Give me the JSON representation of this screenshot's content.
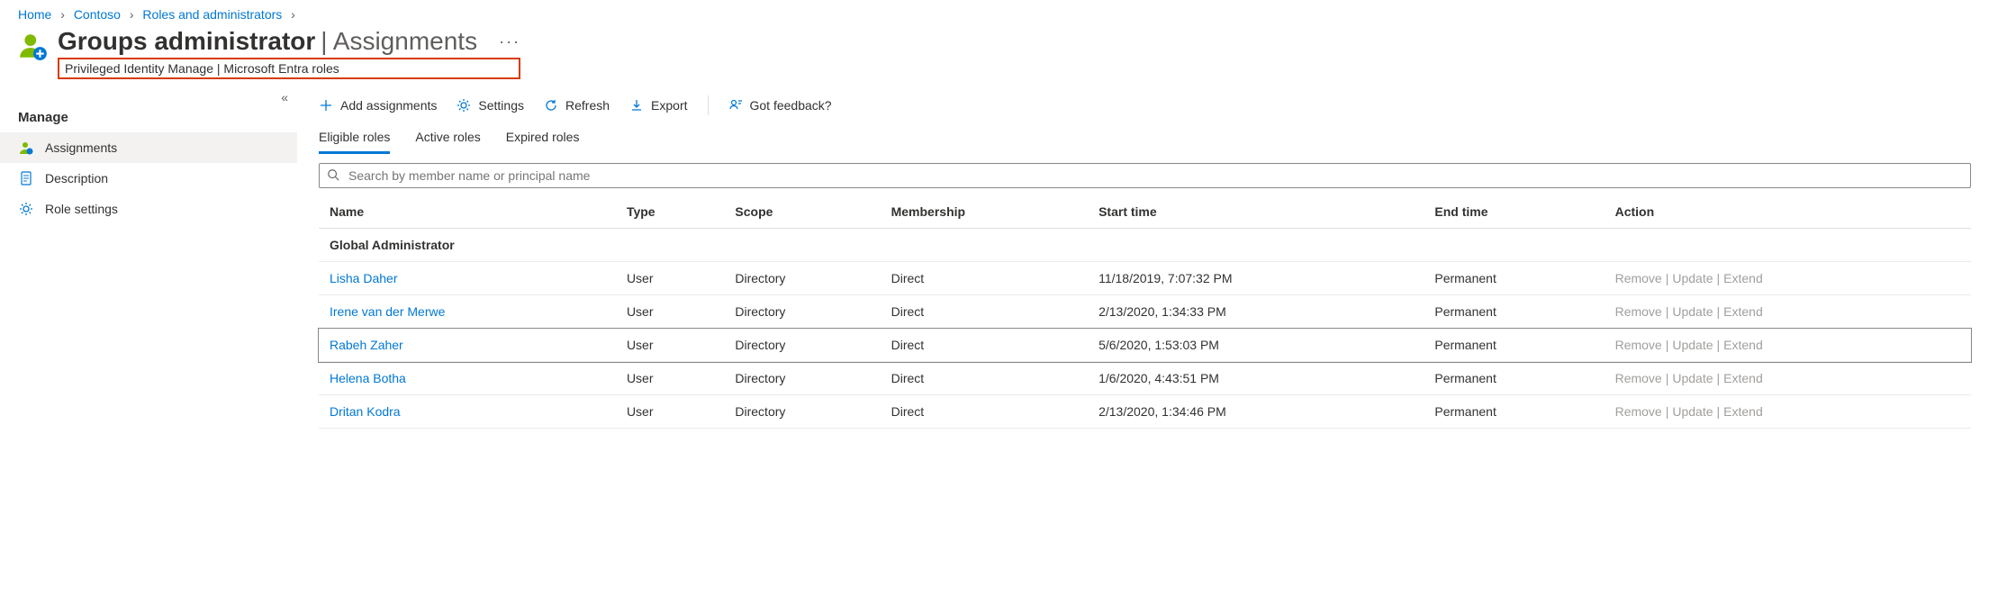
{
  "breadcrumb": [
    {
      "label": "Home"
    },
    {
      "label": "Contoso"
    },
    {
      "label": "Roles and administrators"
    }
  ],
  "title": {
    "bold": "Groups administrator",
    "separator": " | ",
    "light": "Assignments",
    "subtitle": "Privileged Identity Manage | Microsoft Entra roles"
  },
  "sidebar": {
    "heading": "Manage",
    "items": [
      {
        "label": "Assignments",
        "icon": "user-icon",
        "selected": true
      },
      {
        "label": "Description",
        "icon": "doc-icon",
        "selected": false
      },
      {
        "label": "Role settings",
        "icon": "gear-icon",
        "selected": false
      }
    ]
  },
  "toolbar": {
    "add": "Add assignments",
    "settings": "Settings",
    "refresh": "Refresh",
    "export": "Export",
    "feedback": "Got feedback?"
  },
  "tabs": [
    {
      "label": "Eligible roles",
      "active": true
    },
    {
      "label": "Active roles",
      "active": false
    },
    {
      "label": "Expired roles",
      "active": false
    }
  ],
  "search": {
    "placeholder": "Search by member name or principal name"
  },
  "columns": {
    "name": "Name",
    "type": "Type",
    "scope": "Scope",
    "membership": "Membership",
    "start": "Start time",
    "end": "End time",
    "action": "Action"
  },
  "groupHeader": "Global Administrator",
  "rows": [
    {
      "name": "Lisha Daher",
      "type": "User",
      "scope": "Directory",
      "membership": "Direct",
      "start": "11/18/2019, 7:07:32 PM",
      "end": "Permanent",
      "hover": false
    },
    {
      "name": "Irene van der Merwe",
      "type": "User",
      "scope": "Directory",
      "membership": "Direct",
      "start": "2/13/2020, 1:34:33 PM",
      "end": "Permanent",
      "hover": false
    },
    {
      "name": "Rabeh Zaher",
      "type": "User",
      "scope": "Directory",
      "membership": "Direct",
      "start": "5/6/2020, 1:53:03 PM",
      "end": "Permanent",
      "hover": true
    },
    {
      "name": "Helena Botha",
      "type": "User",
      "scope": "Directory",
      "membership": "Direct",
      "start": "1/6/2020, 4:43:51 PM",
      "end": "Permanent",
      "hover": false
    },
    {
      "name": "Dritan Kodra",
      "type": "User",
      "scope": "Directory",
      "membership": "Direct",
      "start": "2/13/2020, 1:34:46 PM",
      "end": "Permanent",
      "hover": false
    }
  ],
  "rowActions": {
    "remove": "Remove",
    "update": "Update",
    "extend": "Extend"
  }
}
